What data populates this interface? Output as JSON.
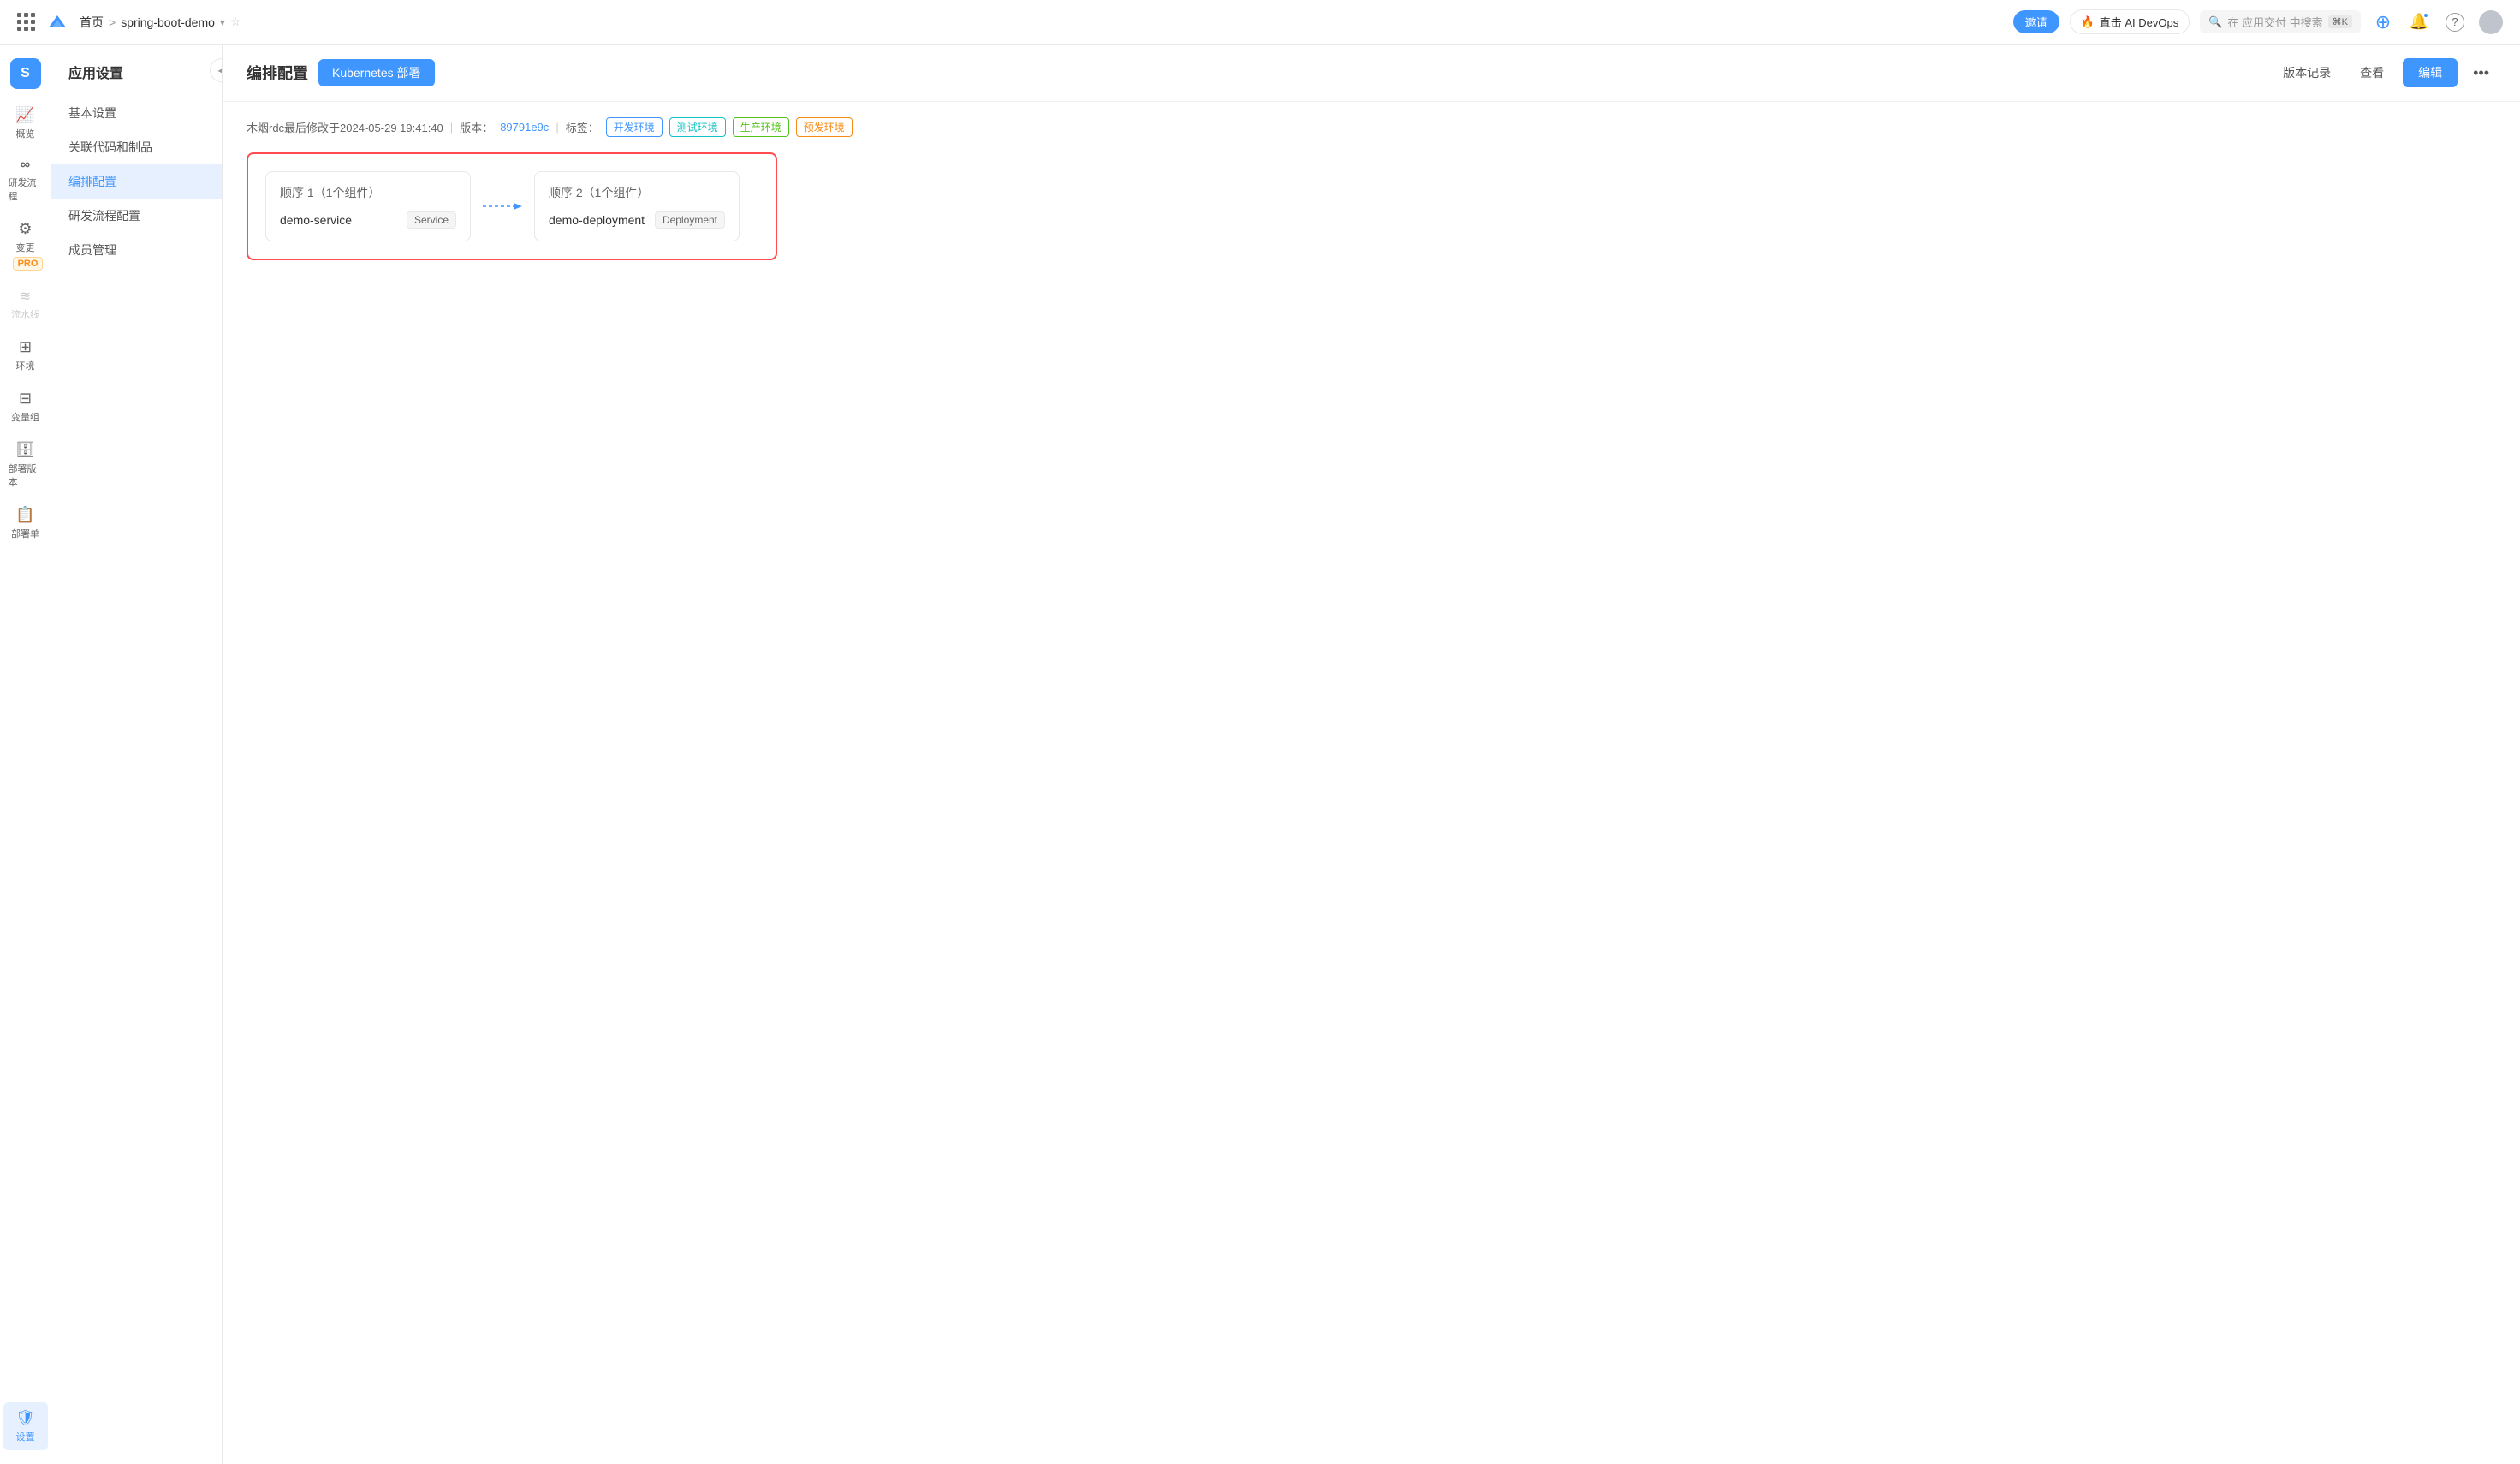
{
  "topNav": {
    "home": "首页",
    "separator": ">",
    "projectName": "spring-boot-demo",
    "inviteLabel": "邀请",
    "aiDevopsLabel": "直击 AI DevOps",
    "searchPlaceholder": "在 应用交付 中搜索",
    "searchShortcut": "⌘K",
    "plusIcon": "+",
    "notificationIcon": "🔔",
    "helpIcon": "?",
    "avatarText": ""
  },
  "leftNav": {
    "appIconLabel": "S",
    "items": [
      {
        "id": "overview",
        "icon": "📈",
        "label": "概览"
      },
      {
        "id": "devflow",
        "icon": "∞",
        "label": "研发流程"
      },
      {
        "id": "change",
        "icon": "⚙",
        "label": "变更",
        "badge": "PRO"
      },
      {
        "id": "pipeline",
        "icon": "$",
        "label": "流水线",
        "disabled": true
      },
      {
        "id": "env",
        "icon": "⊞",
        "label": "环境"
      },
      {
        "id": "vargroup",
        "icon": "⊟",
        "label": "变量组"
      },
      {
        "id": "deploy-ver",
        "icon": "🗄",
        "label": "部署版本"
      },
      {
        "id": "deploy-order",
        "icon": "📋",
        "label": "部署单"
      }
    ],
    "bottomItem": {
      "icon": "🛡",
      "label": "设置"
    }
  },
  "appSidebar": {
    "title": "应用设置",
    "collapseIcon": "◀",
    "menuItems": [
      {
        "id": "basic",
        "label": "基本设置",
        "active": false
      },
      {
        "id": "codeandproduct",
        "label": "关联代码和制品",
        "active": false
      },
      {
        "id": "orchestration",
        "label": "编排配置",
        "active": true
      },
      {
        "id": "devflow-config",
        "label": "研发流程配置",
        "active": false
      },
      {
        "id": "member",
        "label": "成员管理",
        "active": false
      }
    ]
  },
  "contentHeader": {
    "title": "编排配置",
    "activeTab": "Kubernetes 部署",
    "versionHistoryLabel": "版本记录",
    "viewLabel": "查看",
    "editLabel": "编辑",
    "moreIcon": "•••"
  },
  "metaBar": {
    "modifiedBy": "木烟rdc最后修改于2024-05-29 19:41:40",
    "versionLabel": "版本：",
    "versionValue": "89791e9c",
    "tagLabel": "标签：",
    "tags": [
      {
        "id": "dev",
        "label": "开发环境",
        "style": "blue"
      },
      {
        "id": "test",
        "label": "测试环境",
        "style": "cyan"
      },
      {
        "id": "prod",
        "label": "生产环境",
        "style": "green"
      },
      {
        "id": "preprod",
        "label": "预发环境",
        "style": "orange"
      }
    ]
  },
  "orchestration": {
    "stages": [
      {
        "id": "stage1",
        "title": "顺序 1（1个组件）",
        "component": {
          "name": "demo-service",
          "type": "Service"
        }
      },
      {
        "id": "stage2",
        "title": "顺序 2（1个组件）",
        "component": {
          "name": "demo-deployment",
          "type": "Deployment"
        }
      }
    ]
  }
}
